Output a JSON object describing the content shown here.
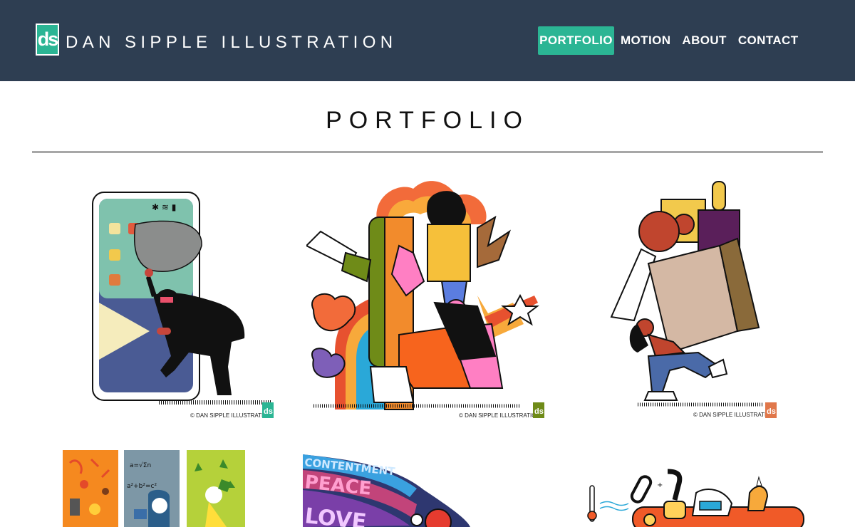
{
  "site": {
    "logo_mark": "ds",
    "brand_name": "DAN SIPPLE ILLUSTRATION"
  },
  "nav": {
    "items": [
      {
        "label": "PORTFOLIO",
        "active": true
      },
      {
        "label": "MOTION",
        "active": false
      },
      {
        "label": "ABOUT",
        "active": false
      },
      {
        "label": "CONTACT",
        "active": false
      }
    ]
  },
  "page": {
    "title": "PORTFOLIO"
  },
  "portfolio": {
    "credit": "© DAN SIPPLE ILLUSTRATION",
    "credit_mark": "ds",
    "items": [
      {
        "subject": "phone-thief-illustration"
      },
      {
        "subject": "peace-sign-crowd-illustration"
      },
      {
        "subject": "shopper-carrying-box-illustration"
      },
      {
        "subject": "poster-triptych-illustration"
      },
      {
        "subject": "contentment-peace-love-illustration",
        "text": [
          "CONTENTMENT",
          "PEACE",
          "LOVE"
        ]
      },
      {
        "subject": "machinery-illustration"
      }
    ]
  },
  "colors": {
    "header_bg": "#2e3e52",
    "accent": "#2bb594",
    "divider": "#a7a7a7"
  }
}
